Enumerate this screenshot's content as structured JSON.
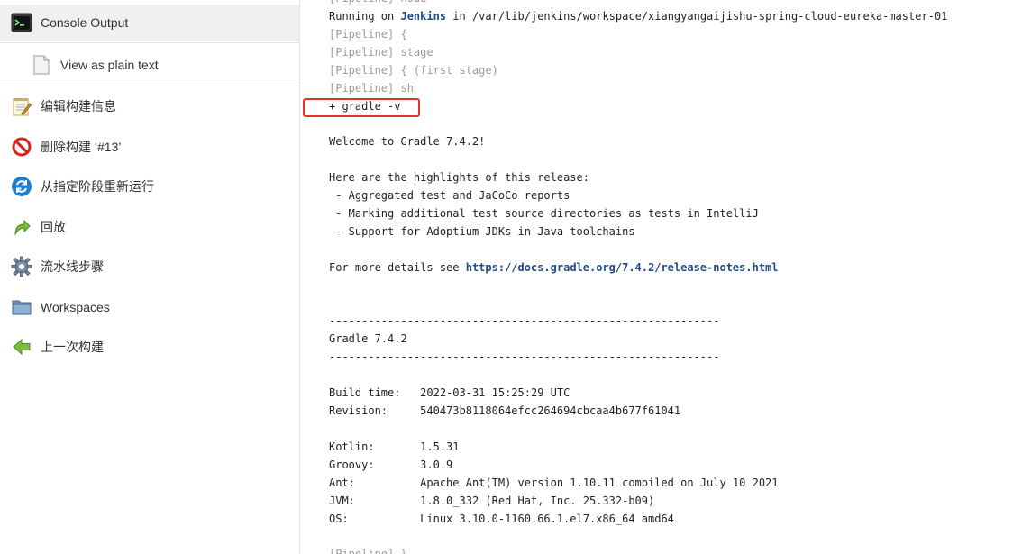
{
  "sidebar": {
    "console_output": "Console Output",
    "view_plain_text": "View as plain text",
    "items": [
      {
        "label": "编辑构建信息"
      },
      {
        "label": "删除构建 ‘#13’"
      },
      {
        "label": "从指定阶段重新运行"
      },
      {
        "label": "回放"
      },
      {
        "label": "流水线步骤"
      },
      {
        "label": "Workspaces"
      },
      {
        "label": "上一次构建"
      }
    ]
  },
  "console": {
    "line_top": "[Pipeline] node",
    "running_prefix": "Running on ",
    "running_node": "Jenkins",
    "running_suffix": " in /var/lib/jenkins/workspace/xiangyangaijishu-spring-cloud-eureka-master-01",
    "p1": "[Pipeline] {",
    "p2": "[Pipeline] stage",
    "p3": "[Pipeline] { (first stage)",
    "p4": "[Pipeline] sh",
    "cmd": "+ gradle -v",
    "welcome": "Welcome to Gradle 7.4.2!",
    "highlights_title": "Here are the highlights of this release:",
    "h1": " - Aggregated test and JaCoCo reports",
    "h2": " - Marking additional test source directories as tests in IntelliJ",
    "h3": " - Support for Adoptium JDKs in Java toolchains",
    "more_prefix": "For more details see ",
    "more_link": "https://docs.gradle.org/7.4.2/release-notes.html",
    "dash1": "------------------------------------------------------------",
    "gradle_ver": "Gradle 7.4.2",
    "dash2": "------------------------------------------------------------",
    "build_time": "Build time:   2022-03-31 15:25:29 UTC",
    "revision": "Revision:     540473b8118064efcc264694cbcaa4b677f61041",
    "kotlin": "Kotlin:       1.5.31",
    "groovy": "Groovy:       3.0.9",
    "ant": "Ant:          Apache Ant(TM) version 1.10.11 compiled on July 10 2021",
    "jvm": "JVM:          1.8.0_332 (Red Hat, Inc. 25.332-b09)",
    "os": "OS:           Linux 3.10.0-1160.66.1.el7.x86_64 amd64",
    "line_bottom": "[Pipeline] }"
  },
  "colors": {
    "highlight_box": "#e2342d",
    "link": "#204a87",
    "pipeline_text": "#9a9a9a"
  }
}
